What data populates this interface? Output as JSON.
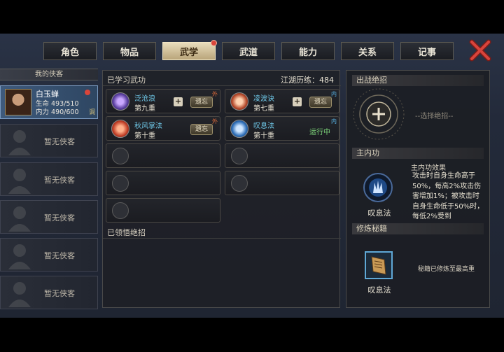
{
  "tabs": [
    {
      "label": "角色",
      "active": false
    },
    {
      "label": "物品",
      "active": false
    },
    {
      "label": "武学",
      "active": true
    },
    {
      "label": "武道",
      "active": false
    },
    {
      "label": "能力",
      "active": false
    },
    {
      "label": "关系",
      "active": false
    },
    {
      "label": "记事",
      "active": false
    }
  ],
  "sidebar": {
    "header": "我的侠客",
    "hero": {
      "name": "白玉蝉",
      "hp_label": "生命",
      "hp": "493/510",
      "mp_label": "内力",
      "mp": "490/600",
      "tune_label": "调"
    },
    "empty_slots": [
      "暂无侠客",
      "暂无侠客",
      "暂无侠客",
      "暂无侠客",
      "暂无侠客"
    ]
  },
  "main": {
    "learned_title": "已学习武功",
    "exp_label": "江湖历练：484",
    "skills": [
      {
        "name": "泛沧浪",
        "level": "第九重",
        "tag": "外",
        "action": "遗忘",
        "has_plus": true
      },
      {
        "name": "凌波诀",
        "level": "第七重",
        "tag": "内",
        "action": "遗忘",
        "has_plus": true
      },
      {
        "name": "秋风掌法",
        "level": "第十重",
        "tag": "外",
        "action": "遗忘",
        "has_plus": false
      },
      {
        "name": "叹息法",
        "level": "第十重",
        "tag": "内",
        "status": "运行中",
        "has_plus": false
      }
    ],
    "ultimate_title": "已领悟绝招"
  },
  "right": {
    "battle_title": "出战绝招",
    "choose_hint": "--选择绝招--",
    "inner_title": "主内功",
    "inner_skill": "叹息法",
    "effect_title": "主内功效果",
    "effect_text": "攻击时自身生命高于50%，每高2%攻击伤害增加1%；被攻击时自身生命低于50%时，每低2%受到",
    "book_title": "修炼秘籍",
    "book_name": "叹息法",
    "book_note": "秘籍已修炼至最高重"
  },
  "colors": {
    "accent_tab": "#d9c79c",
    "skill_name": "#6fc8e8",
    "running": "#7ed67a",
    "close": "#c93a35"
  }
}
